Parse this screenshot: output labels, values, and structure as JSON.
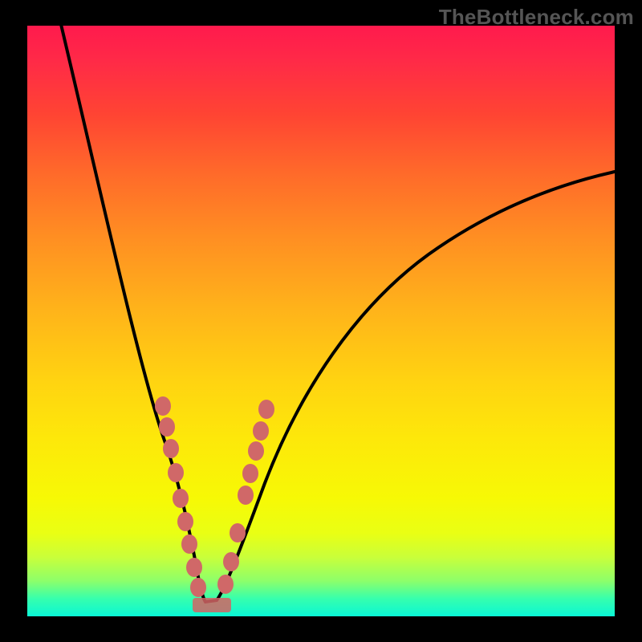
{
  "watermark": "TheBottleneck.com",
  "chart_data": {
    "type": "line",
    "title": "",
    "xlabel": "",
    "ylabel": "",
    "xlim": [
      0,
      100
    ],
    "ylim": [
      0,
      100
    ],
    "series": [
      {
        "name": "curve",
        "x": [
          5,
          10,
          15,
          18,
          20,
          22,
          24,
          26,
          27,
          28,
          29,
          30,
          35,
          40,
          45,
          50,
          55,
          60,
          65,
          70,
          80,
          90,
          100
        ],
        "y": [
          100,
          82,
          63,
          51,
          43,
          34,
          24,
          13,
          7,
          3,
          1,
          1,
          9,
          21,
          31,
          40,
          47,
          53,
          58,
          62,
          68,
          72,
          75
        ]
      }
    ],
    "left_markers_y": [
      36,
      32,
      28,
      23,
      19,
      15,
      12,
      8,
      5
    ],
    "right_markers_y": [
      34,
      30,
      27,
      23,
      20,
      13,
      8,
      5
    ],
    "bottom_bar_y": 1,
    "colors": {
      "curve": "#000000",
      "markers": "#d06868",
      "gradient_top": "#ff1a4d",
      "gradient_bottom": "#0af7d6",
      "frame": "#000000"
    }
  }
}
